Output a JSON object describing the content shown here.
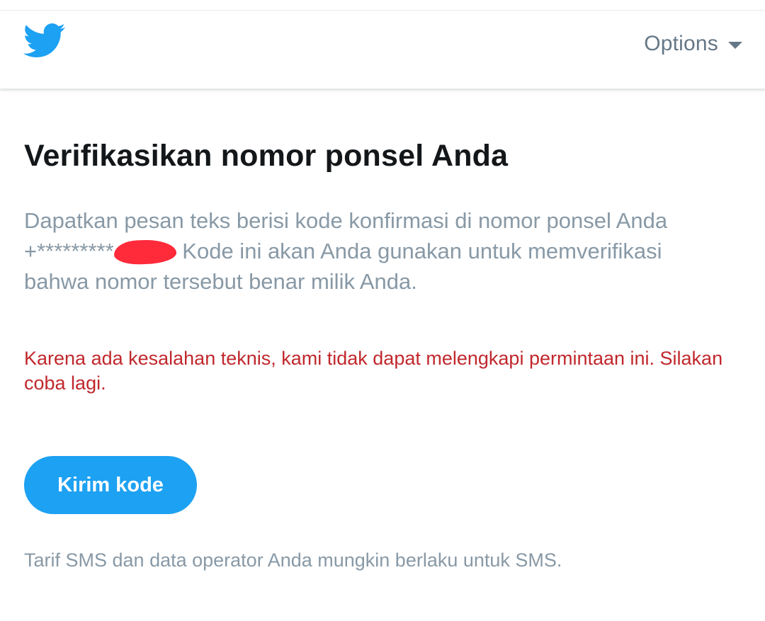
{
  "header": {
    "logo_icon": "twitter-bird-icon",
    "brand_color": "#1da1f2",
    "options_label": "Options",
    "options_icon": "caret-down-icon"
  },
  "main": {
    "title": "Verifikasikan nomor ponsel Anda",
    "description_before": "Dapatkan pesan teks berisi kode konfirmasi di nomor ponsel Anda +*********",
    "description_after": " Kode ini akan Anda gunakan untuk memverifikasi bahwa nomor tersebut benar milik Anda.",
    "error_message": "Karena ada kesalahan teknis, kami tidak dapat melengkapi permintaan ini. Silakan coba lagi.",
    "send_button_label": "Kirim kode",
    "sms_note": "Tarif SMS dan data operator Anda mungkin berlaku untuk SMS."
  },
  "colors": {
    "error": "#c0282d",
    "muted_text": "#8899a6",
    "title_text": "#14171a",
    "redaction": "#ff2a3a"
  }
}
